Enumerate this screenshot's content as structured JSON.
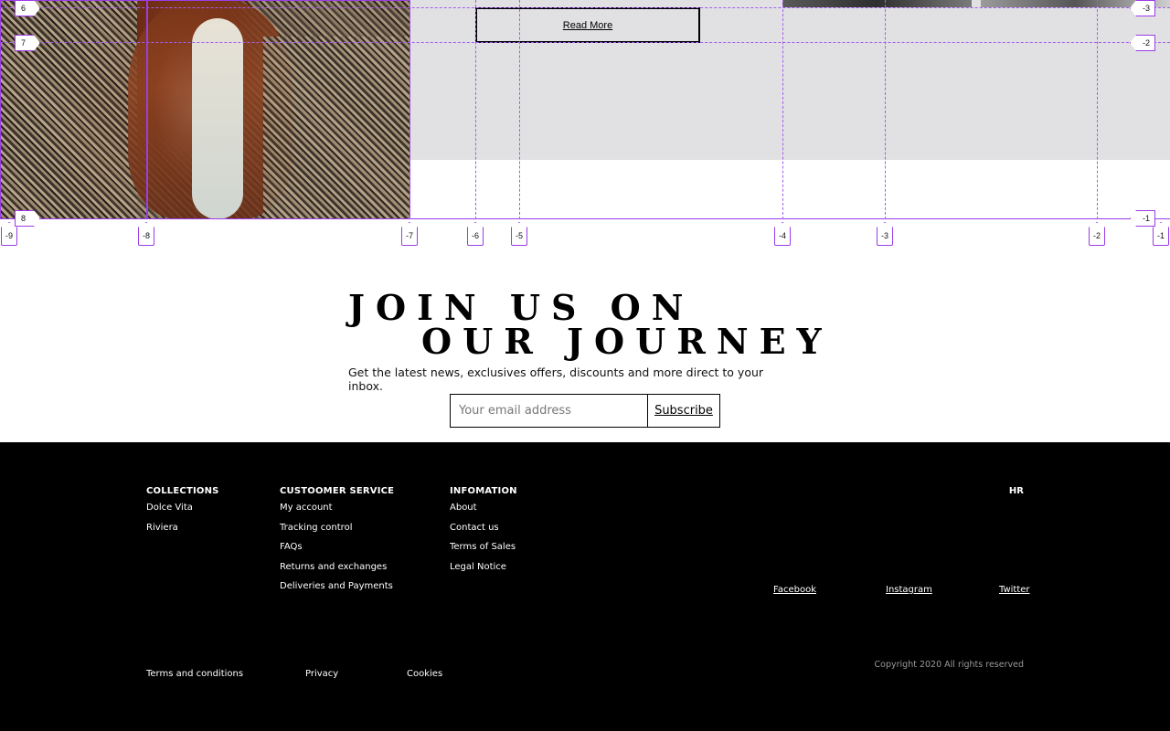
{
  "hero": {
    "read_more_label": "Read More"
  },
  "overlay": {
    "bottom_markers": [
      "-9",
      "-8",
      "-7",
      "-6",
      "-5",
      "-4",
      "-3",
      "-2",
      "-1"
    ],
    "left_markers": [
      "6",
      "7",
      "8"
    ],
    "right_markers": [
      "-3",
      "-2",
      "-1"
    ]
  },
  "newsletter": {
    "title_line1": "JOIN US ON",
    "title_line2": "OUR JOURNEY",
    "subtitle": "Get the latest news, exclusives offers, discounts and more direct to your inbox.",
    "email_placeholder": "Your email address",
    "subscribe_label": "Subscribe"
  },
  "footer": {
    "collections": {
      "heading": "COLLECTIONS",
      "items": [
        "Dolce Vita",
        "Riviera"
      ]
    },
    "customer_service": {
      "heading": "CUSTOOMER SERVICE",
      "items": [
        "My account",
        "Tracking control",
        "FAQs",
        "Returns and exchanges",
        "Deliveries and Payments"
      ]
    },
    "information": {
      "heading": "INFOMATION",
      "items": [
        "About",
        "Contact us",
        "Terms of Sales",
        "Legal Notice"
      ]
    },
    "language": "HR",
    "social": {
      "facebook": "Facebook",
      "instagram": "Instagram",
      "twitter": "Twitter"
    },
    "legal": {
      "terms": "Terms and conditions",
      "privacy": "Privacy",
      "cookies": "Cookies"
    },
    "copyright": "Copyright 2020 All rights reserved"
  }
}
